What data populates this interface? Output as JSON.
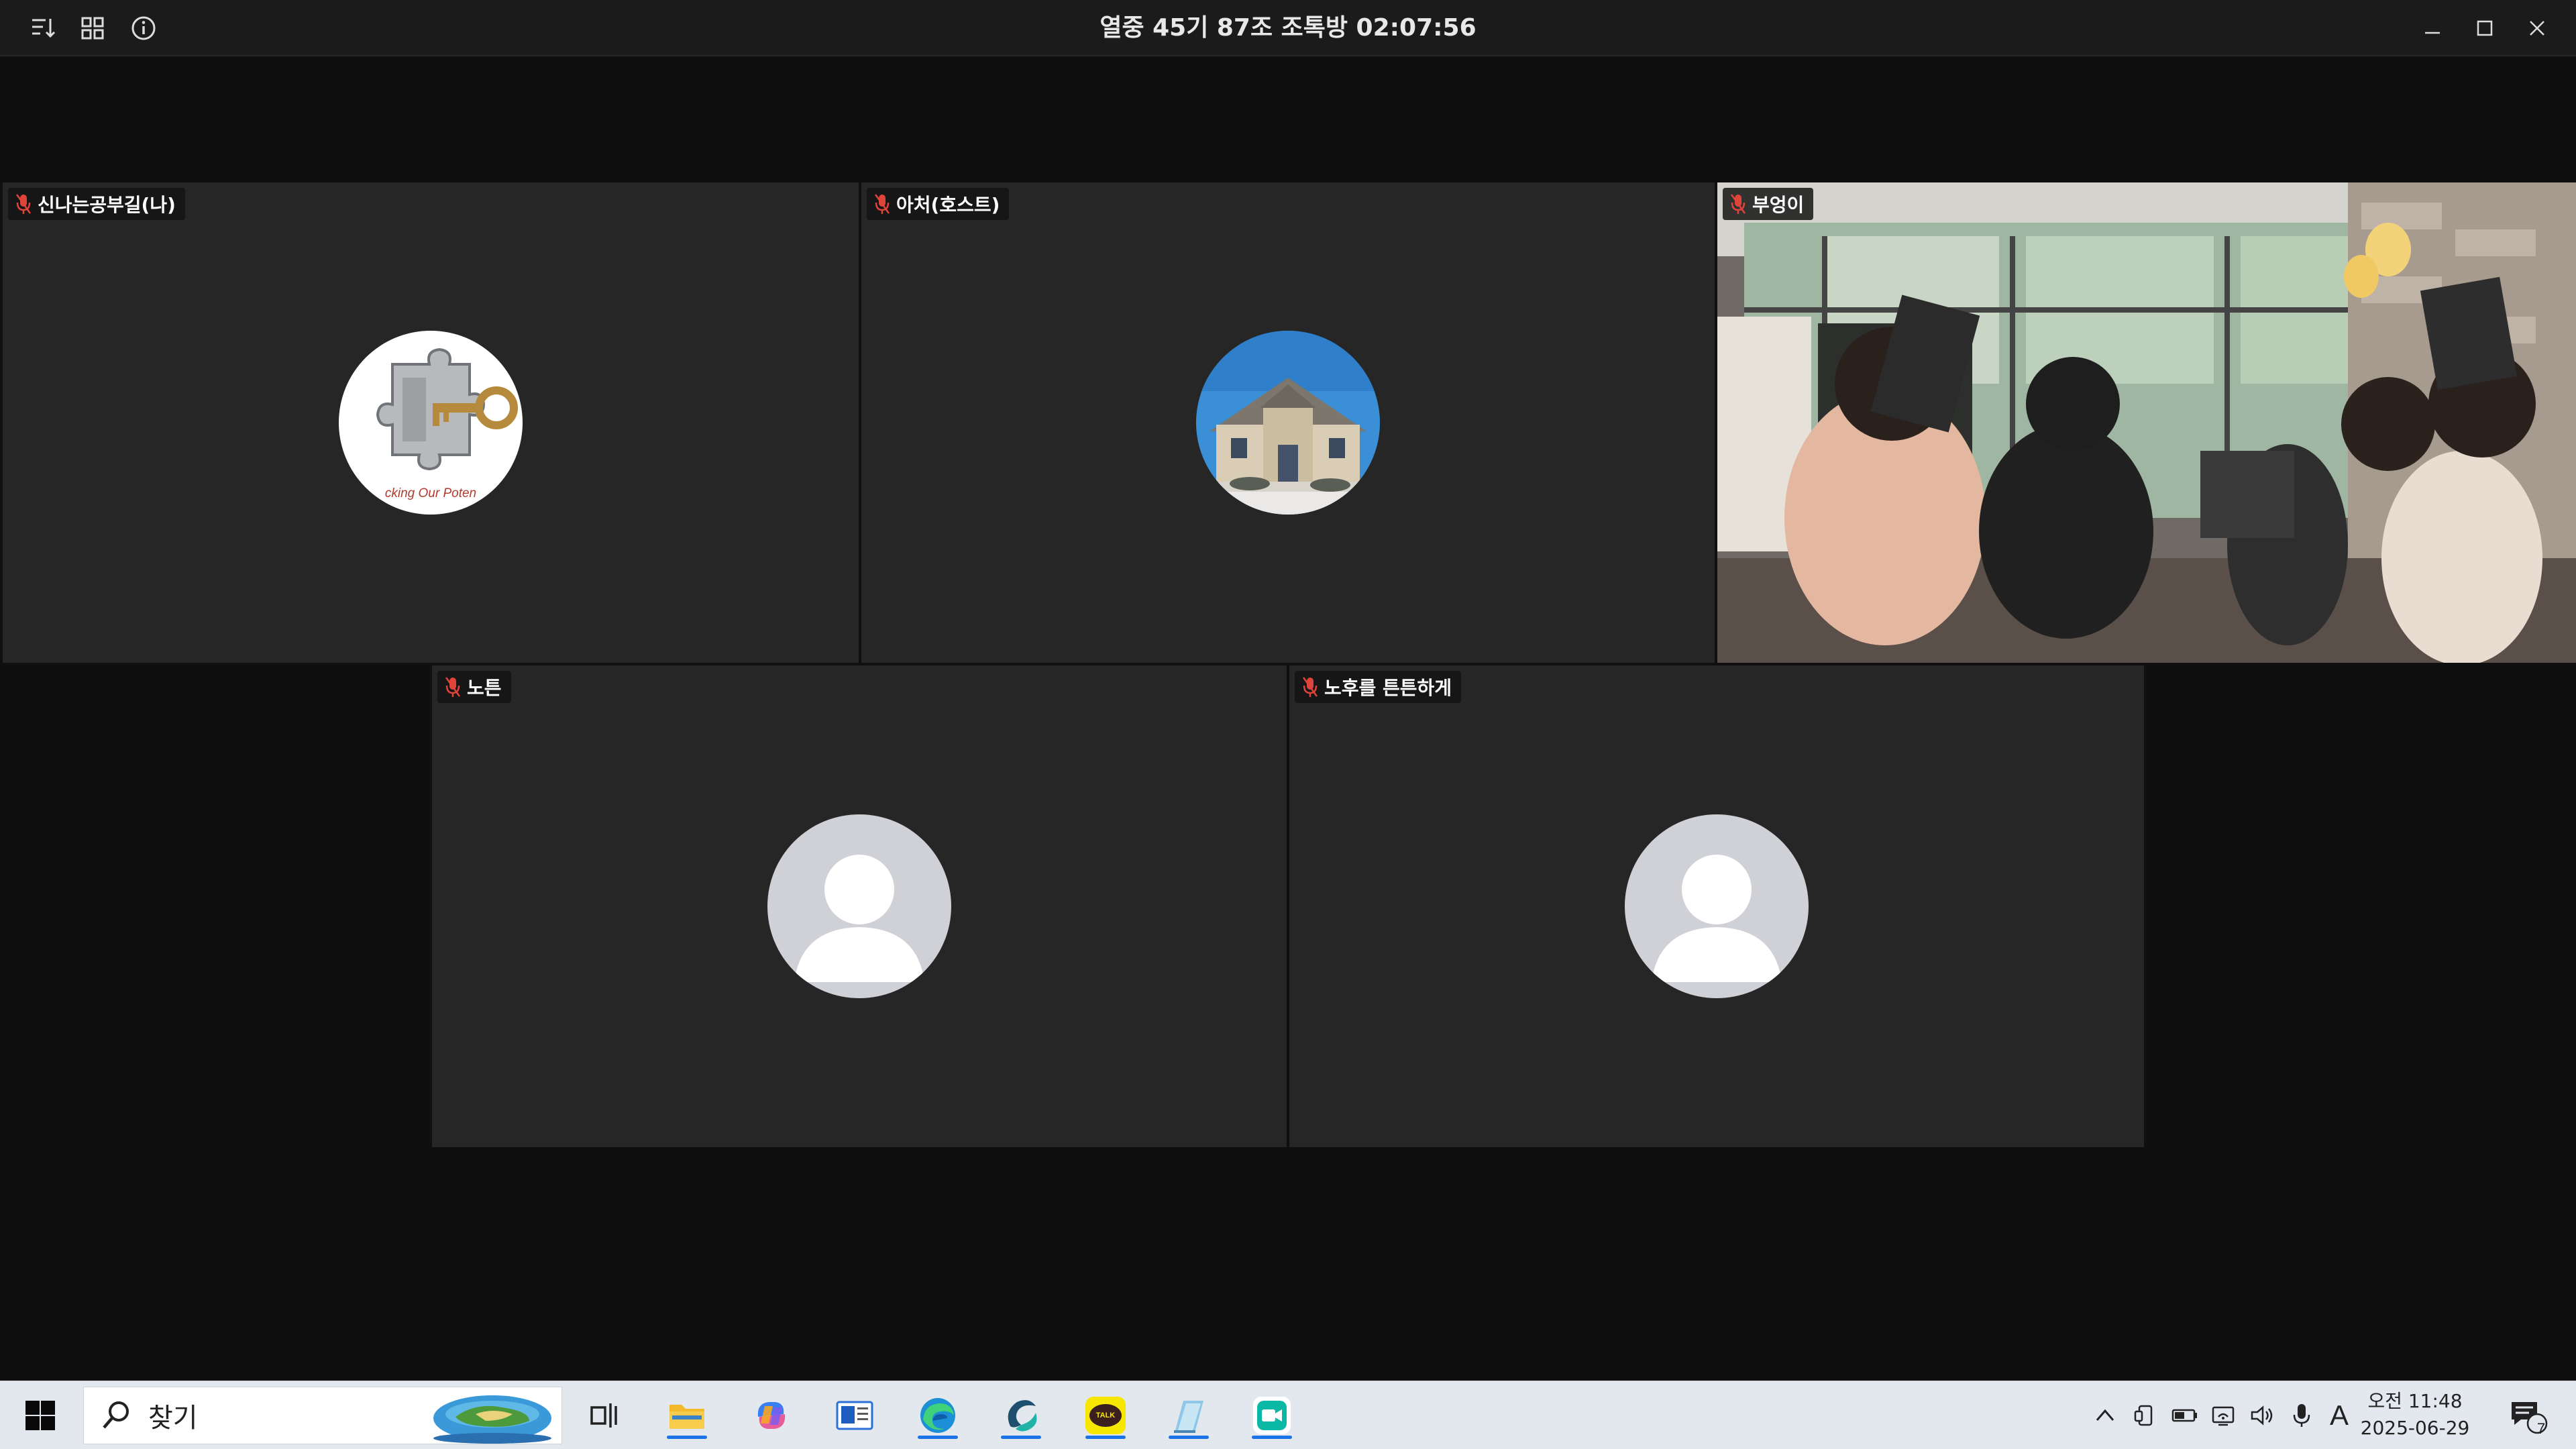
{
  "window": {
    "title": "열중 45기 87조 조톡방 02:07:56"
  },
  "participants": [
    {
      "name": "신나는공부길(나)",
      "avatar_type": "puzzle-key-logo",
      "avatar_text": "cking Our Poten"
    },
    {
      "name": "아처(호스트)",
      "avatar_type": "house-photo"
    },
    {
      "name": "부엉이",
      "avatar_type": "live-video"
    },
    {
      "name": "노튼",
      "avatar_type": "default-silhouette"
    },
    {
      "name": "노후를 튼튼하게",
      "avatar_type": "default-silhouette"
    }
  ],
  "taskbar": {
    "search_label": "찾기",
    "apps": [
      "file-explorer",
      "copilot",
      "news",
      "edge",
      "app-swirl",
      "kakaotalk",
      "notes",
      "video-meeting"
    ],
    "kakaotalk_label": "TALK",
    "ime_label": "A",
    "clock": {
      "time": "오전 11:48",
      "date": "2025-06-29"
    },
    "notification_count": "7"
  },
  "colors": {
    "window_bg": "#0f0f0f",
    "tile_bg": "#262626",
    "mic_off": "#e0433a",
    "taskbar_bg": "#e3e8ef"
  }
}
